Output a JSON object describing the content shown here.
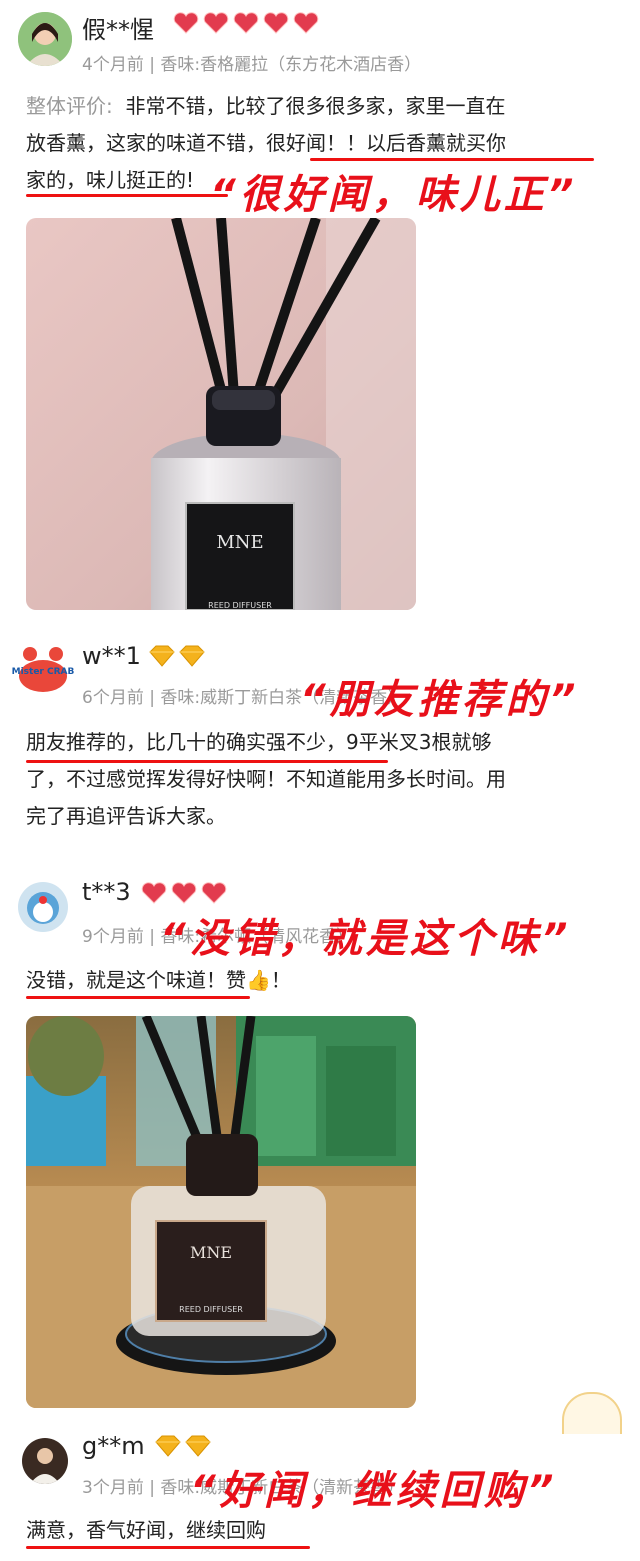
{
  "reviews": [
    {
      "username": "假**惺",
      "meta": "4个月前 | 香味:香格麗拉（东方花木酒店香）",
      "label": "整体评价:",
      "text_line1": "非常不错，比较了很多很多家，家里一直在",
      "text_line2a": "放香薰，这家的味道不错，",
      "text_line2b": "很好闻！！以后香薰就买你",
      "text_line3": "家的，味儿挺正的!",
      "callout": "“很好闻，味儿正”",
      "badge_type": "heart",
      "badge_count": 5,
      "photo": {
        "brand": "MNE",
        "label": "REED DIFFUSER"
      }
    },
    {
      "username": "w**1",
      "meta": "6个月前 | 香味:威斯丁新白茶（清新茶香）",
      "text_line1a": "朋友推荐的，比几十的确实强不少，",
      "text_line1b": "9平米叉3根就够",
      "text_line2": "了，不过感觉挥发得好快啊！不知道能用多长时间。用",
      "text_line3": "完了再追评告诉大家。",
      "callout": "“朋友推荐的”",
      "badge_type": "diamond",
      "badge_count": 2,
      "avatar_text": "Mister CRAB"
    },
    {
      "username": "t**3",
      "meta": "9个月前 | 香味:希尔顿（清风花香）",
      "text_line1a": "没错，就是这个味道！",
      "text_line1b": "赞",
      "text_line1c": "👍",
      "text_line1d": "！",
      "callout": "“没错，就是这个味”",
      "badge_type": "heart",
      "badge_count": 3,
      "photo": {
        "brand": "MNE",
        "label": "REED DIFFUSER"
      }
    },
    {
      "username": "g**m",
      "meta": "3个月前 | 香味:威斯丁新白茶（清新茶香）",
      "text_line1": "满意，香气好闻，继续回购",
      "callout": "“好闻，继续回购”",
      "badge_type": "diamond",
      "badge_count": 2
    }
  ],
  "colors": {
    "accent": "#e8101a",
    "muted": "#9a9a9a",
    "heart": "#e23b4e",
    "diamond": "#f4b21c"
  }
}
